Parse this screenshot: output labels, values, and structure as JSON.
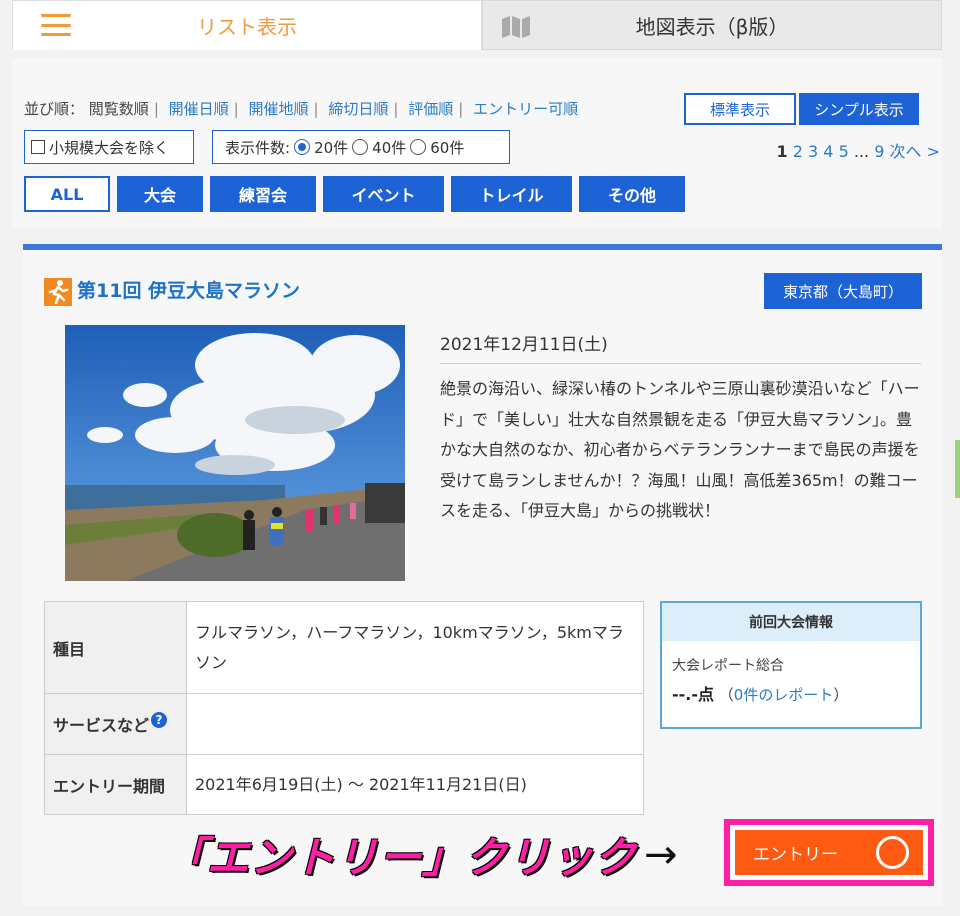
{
  "tabs": {
    "list_label": "リスト表示",
    "map_label": "地図表示（β版）"
  },
  "controls": {
    "sort_prefix": "並び順：",
    "sort_current": "閲覧数順",
    "sort_links": [
      "開催日順",
      "開催地順",
      "締切日順",
      "評価順",
      "エントリー可順"
    ],
    "view_standard": "標準表示",
    "view_simple": "シンプル表示",
    "exclude_small": "小規模大会を除く",
    "count_label": "表示件数:",
    "count_options": [
      "20件",
      "40件",
      "60件"
    ],
    "count_selected": "20件",
    "pager": {
      "current": "1",
      "pages": [
        "2",
        "3",
        "4",
        "5"
      ],
      "ellipsis": "...",
      "last": "9",
      "next": "次へ >"
    },
    "categories": [
      "ALL",
      "大会",
      "練習会",
      "イベント",
      "トレイル",
      "その他"
    ],
    "category_active": "ALL"
  },
  "event": {
    "title": "第11回 伊豆大島マラソン",
    "region": "東京都（大島町）",
    "date": "2021年12月11日(土)",
    "description": "絶景の海沿い、緑深い椿のトンネルや三原山裏砂漠沿いなど「ハード」で「美しい」壮大な自然景観を走る「伊豆大島マラソン」。豊かな大自然のなか、初心者からベテランランナーまで島民の声援を受けて島ランしませんか！？海風！山風！高低差365m！の難コースを走る、「伊豆大島」からの挑戦状！",
    "table": {
      "event_type_label": "種目",
      "event_type_value": "フルマラソン，ハーフマラソン，10kmマラソン，5kmマラソン",
      "services_label": "サービスなど",
      "services_value": "",
      "entry_period_label": "エントリー期間",
      "entry_period_value": "2021年6月19日(土) 〜 2021年11月21日(日)"
    },
    "prev": {
      "heading": "前回大会情報",
      "report_label": "大会レポート総合",
      "score": "--.-点",
      "report_link": "0件のレポート"
    },
    "entry_button": "エントリー"
  },
  "annotation": {
    "text": "「エントリー」クリック",
    "arrow": "→"
  }
}
